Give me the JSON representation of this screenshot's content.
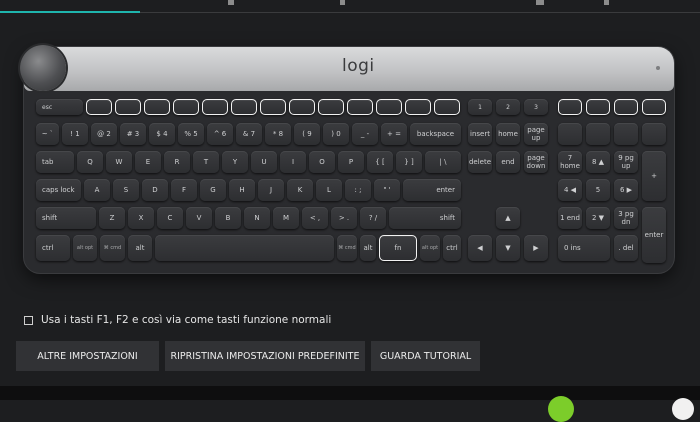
{
  "keyboard": {
    "logo": "logi",
    "rows": [
      [
        "esc",
        "",
        "",
        "",
        "",
        "",
        "",
        "",
        "",
        "",
        "",
        "",
        "",
        "1",
        "2",
        "3",
        "",
        "",
        "",
        ""
      ],
      [
        "~ `",
        "! 1",
        "@ 2",
        "# 3",
        "$ 4",
        "% 5",
        "^ 6",
        "& 7",
        "* 8",
        "( 9",
        ") 0",
        "_ -",
        "+ =",
        "backspace",
        "insert",
        "home",
        "page up",
        "",
        "",
        "",
        ""
      ],
      [
        "tab",
        "Q",
        "W",
        "E",
        "R",
        "T",
        "Y",
        "U",
        "I",
        "O",
        "P",
        "{ [",
        "} ]",
        "| \\",
        "delete",
        "end",
        "page down",
        "7 home",
        "8 ▲",
        "9 pg up",
        "+"
      ],
      [
        "caps lock",
        "A",
        "S",
        "D",
        "F",
        "G",
        "H",
        "J",
        "K",
        "L",
        ": ;",
        "\" '",
        "enter",
        "4 ◀",
        "5",
        "6 ▶"
      ],
      [
        "shift",
        "Z",
        "X",
        "C",
        "V",
        "B",
        "N",
        "M",
        "< ,",
        "> .",
        "? /",
        "shift",
        "▲",
        "1 end",
        "2 ▼",
        "3 pg dn",
        "enter"
      ],
      [
        "ctrl",
        "alt opt",
        "⌘ cmd",
        "alt",
        "",
        "⌘ cmd",
        "alt",
        "fn",
        "alt opt",
        "ctrl",
        "◀",
        "▼",
        "▶",
        "0 ins",
        ". del"
      ]
    ]
  },
  "settings": {
    "checkbox_label": "Usa i tasti F1, F2 e così via come tasti funzione normali"
  },
  "buttons": {
    "other_settings": "ALTRE IMPOSTAZIONI",
    "restore_defaults": "RIPRISTINA IMPOSTAZIONI PREDEFINITE",
    "watch_tutorial": "GUARDA TUTORIAL"
  },
  "colors": {
    "accent": "#1fb5ad",
    "background": "#1d1e20",
    "button": "#313235"
  }
}
